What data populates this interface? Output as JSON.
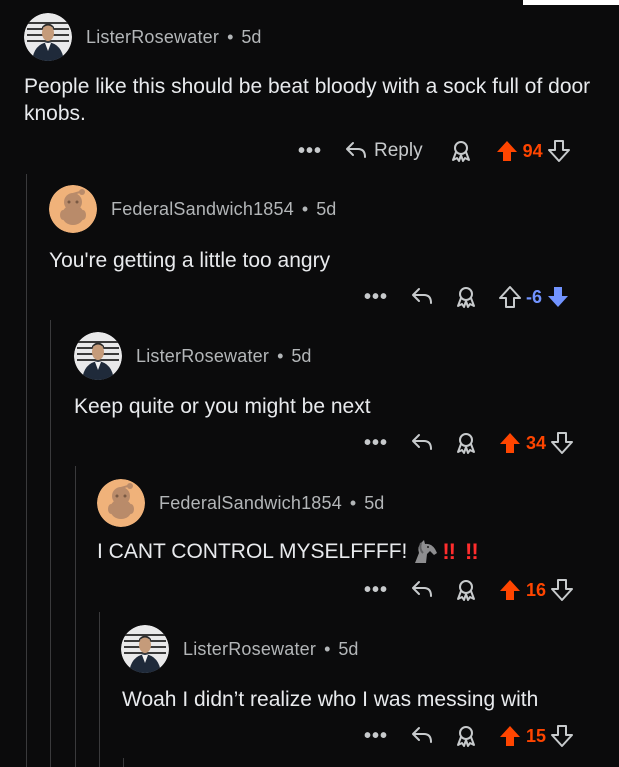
{
  "colors": {
    "background": "#0b0b0c",
    "upvote_active": "#ff4500",
    "downvote_active": "#7193ff",
    "meta_text": "#b3b6b8"
  },
  "comments": [
    {
      "username": "ListerRosewater",
      "separator": "•",
      "age": "5d",
      "avatar": "profile-photo-avatar",
      "text": "People like this should be beat bloody with a sock full of door knobs.",
      "more": "•••",
      "reply_label": "Reply",
      "score": "94",
      "vote_state": "upvoted"
    },
    {
      "username": "FederalSandwich1854",
      "separator": "•",
      "age": "5d",
      "avatar": "snoo-avatar",
      "text": "You're getting a little too angry",
      "more": "•••",
      "score": "-6",
      "vote_state": "downvoted"
    },
    {
      "username": "ListerRosewater",
      "separator": "•",
      "age": "5d",
      "avatar": "profile-photo-avatar",
      "text": "Keep quite or you might be next",
      "more": "•••",
      "score": "34",
      "vote_state": "upvoted"
    },
    {
      "username": "FederalSandwich1854",
      "separator": "•",
      "age": "5d",
      "avatar": "snoo-avatar",
      "text": "I CANT CONTROL MYSELFFFF!",
      "emojis": [
        "horse-emoji",
        "double-exclamation-emoji",
        "double-exclamation-emoji"
      ],
      "bang_1": "!!",
      "bang_2": "!!",
      "more": "•••",
      "score": "16",
      "vote_state": "upvoted"
    },
    {
      "username": "ListerRosewater",
      "separator": "•",
      "age": "5d",
      "avatar": "profile-photo-avatar",
      "text": "Woah I didn’t realize who I was messing with",
      "more": "•••",
      "score": "15",
      "vote_state": "upvoted"
    }
  ]
}
